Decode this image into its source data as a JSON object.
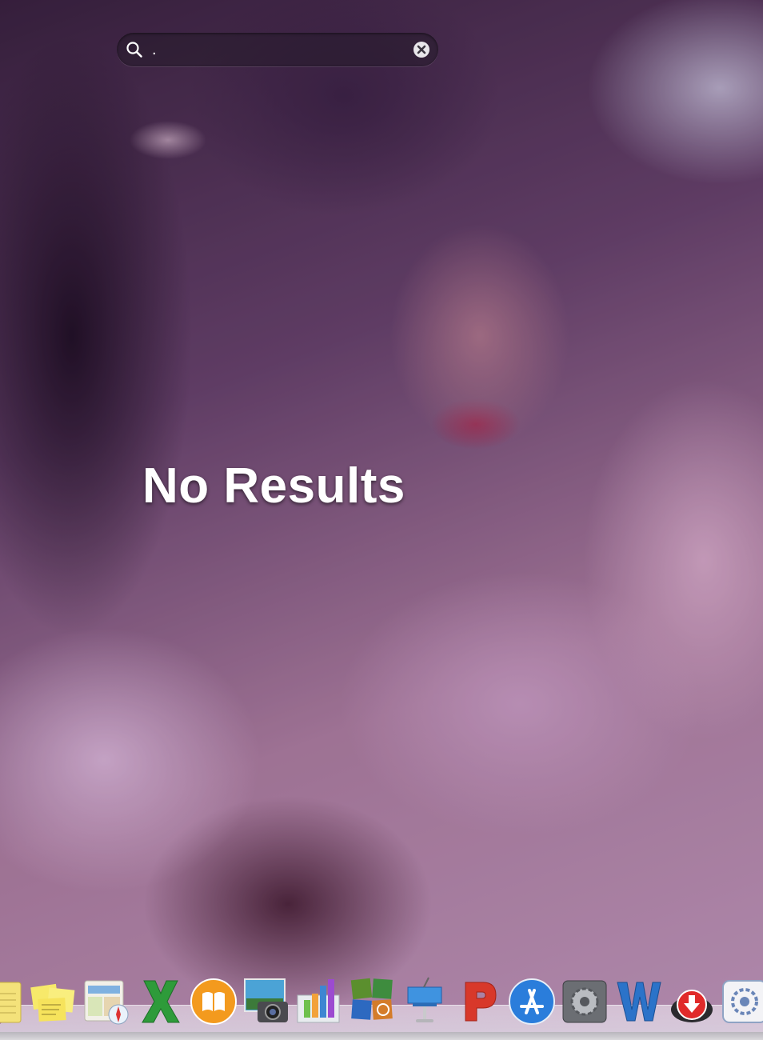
{
  "search": {
    "value": ".",
    "placeholder": ""
  },
  "results": {
    "message": "No Results"
  },
  "dock": {
    "items": [
      {
        "name": "notes-icon"
      },
      {
        "name": "stickies-icon"
      },
      {
        "name": "maps-safari-icon"
      },
      {
        "name": "excel-icon"
      },
      {
        "name": "ibooks-icon"
      },
      {
        "name": "image-capture-icon"
      },
      {
        "name": "numbers-icon"
      },
      {
        "name": "launchpad-icon"
      },
      {
        "name": "keynote-icon"
      },
      {
        "name": "powerpoint-icon"
      },
      {
        "name": "app-store-icon"
      },
      {
        "name": "system-preferences-icon"
      },
      {
        "name": "word-icon"
      },
      {
        "name": "downloader-icon"
      },
      {
        "name": "preferences-icon"
      }
    ]
  },
  "colors": {
    "text": "#ffffff",
    "excel_green": "#2e9b3a",
    "ibooks_orange": "#f39a1e",
    "powerpoint_red": "#d8382a",
    "app_store_blue": "#2a7ddb",
    "word_blue": "#2b73c9"
  }
}
